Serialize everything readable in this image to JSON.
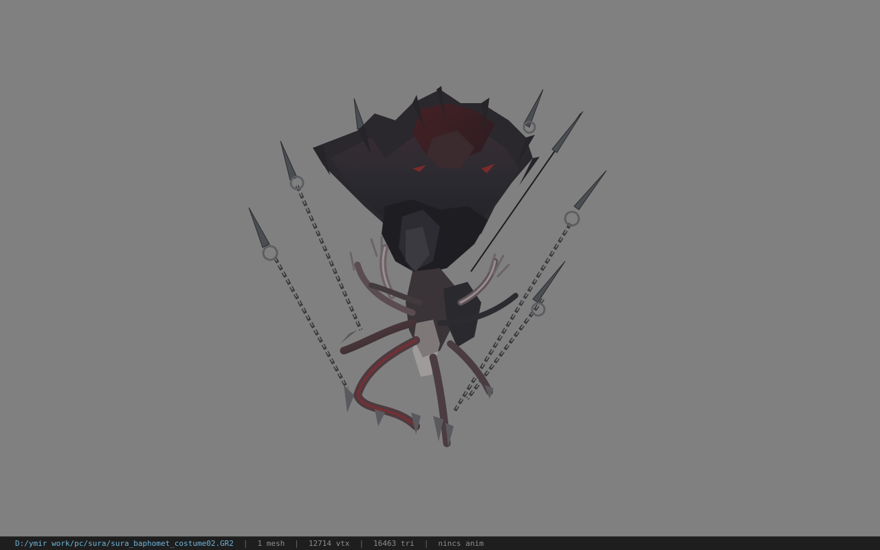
{
  "viewport": {
    "background": "#808080",
    "model": "sura-baphomet-costume-render"
  },
  "status_bar": {
    "file_path": "D:/ymir work/pc/sura/sura_baphomet_costume02.GR2",
    "separator": "|",
    "mesh_count": "1 mesh",
    "vertex_count": "12714 vtx",
    "triangle_count": "16463 tri",
    "anim_status": "nincs anim",
    "path_color": "#6fb3d8"
  }
}
